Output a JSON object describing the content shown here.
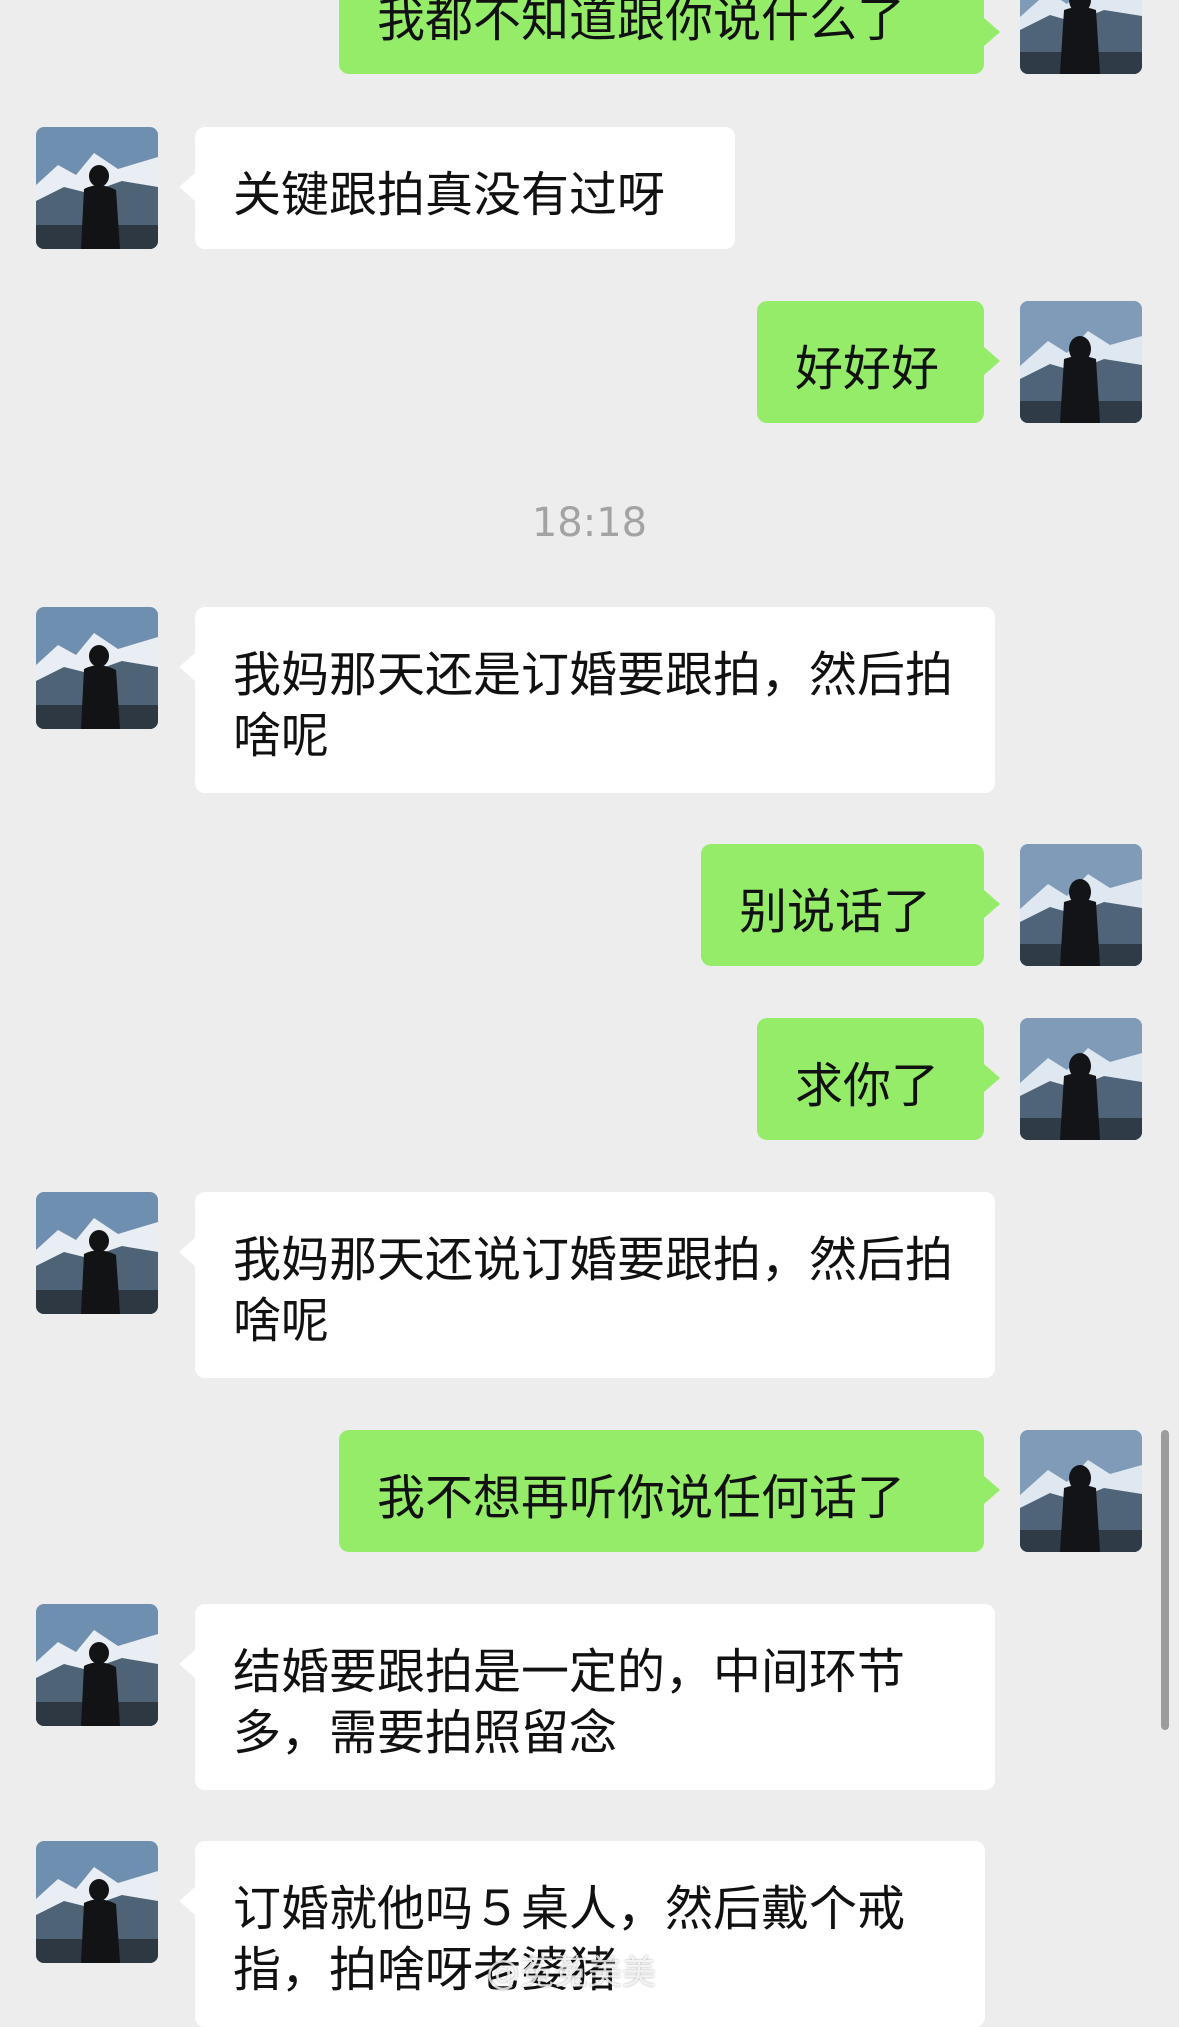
{
  "chat": {
    "timestamp": "18:18",
    "messages": [
      {
        "side": "out",
        "text": "我都不知道跟你说什么了"
      },
      {
        "side": "in",
        "text": "关键跟拍真没有过呀"
      },
      {
        "side": "out",
        "text": "好好好"
      },
      {
        "side": "in",
        "text": "我妈那天还是订婚要跟拍，然后拍啥呢"
      },
      {
        "side": "out",
        "text": "别说话了"
      },
      {
        "side": "out",
        "text": "求你了"
      },
      {
        "side": "in",
        "text": "我妈那天还说订婚要跟拍，然后拍啥呢"
      },
      {
        "side": "out",
        "text": "我不想再听你说任何话了"
      },
      {
        "side": "in",
        "text": "结婚要跟拍是一定的，中间环节多，需要拍照留念"
      },
      {
        "side": "in",
        "text": "订婚就他吗５桌人，然后戴个戒指，拍啥呀老婆猪"
      }
    ]
  },
  "avatars": {
    "incoming": "boy-mountain-avatar",
    "outgoing": "girl-mountain-avatar"
  },
  "watermark": "@菟菟美美"
}
